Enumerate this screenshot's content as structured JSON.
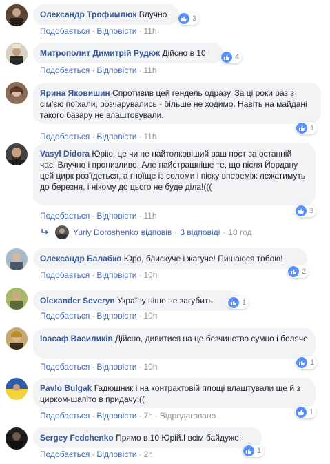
{
  "labels": {
    "like": "Подобається",
    "reply": "Відповісти",
    "edited": "Відредаговано",
    "separator": "·"
  },
  "comments": [
    {
      "author": "Олександр Трофимлюк",
      "text": "Влучно",
      "time": "11h",
      "reactions": "3",
      "avatar_color": "#4a3a2e"
    },
    {
      "author": "Митрополит Димитрій Рудюк",
      "text": "Дійсно в 10",
      "time": "11h",
      "reactions": "4",
      "avatar_color": "#6b5a3a"
    },
    {
      "author": "Ярина Яковишин",
      "text": "Спротивив цей гендель одразу. За ці роки раз з сім'єю поїхали, розчарувались - більше не ходимо. Навіть на майдані такого базару не влаштовували.",
      "time": "11h",
      "reactions": "1",
      "avatar_color": "#7a5a48"
    },
    {
      "author": "Vasyl Didora",
      "text": "Юрію, це чи не найтолковіший ваш пост за останній час! Влучно і пронизливо. Але найстрашніше те, що після Йордану цей цирк роз'їдеться, а гноїще із соломи і піску впереміж лежатимуть до березня, і нікому до цього не буде діла!(((",
      "time": "11h",
      "reactions": "3",
      "avatar_color": "#3b3b3b"
    },
    {
      "author": "Олександр Балабко",
      "text": "Юро, блискуче і жагуче! Пишаюся тобою!",
      "time": "10h",
      "reactions": "2",
      "avatar_color": "#8fa4b8"
    },
    {
      "author": "Olexander Severyn",
      "text": "Україну ніщо не загубить",
      "time": "10h",
      "reactions": "1",
      "avatar_color": "#9aa860"
    },
    {
      "author": "Іоасаф Василиків",
      "text": "Дійсно, дивитися на це безчинство сумно і боляче",
      "time": "10h",
      "reactions": "1",
      "avatar_color": "#a68450"
    },
    {
      "author": "Pavlo Bulgak",
      "text": "Гадюшник і на контрактовій площі влаштували ще й з цирком-шапіто в придачу:((",
      "time": "7h",
      "reactions": "1",
      "edited": true,
      "avatar_color": "#2f5aa8"
    },
    {
      "author": "Sergey Fedchenko",
      "text": "Прямо в 10 Юрій.І всім байдуже!",
      "time": "2h",
      "reactions": "1",
      "avatar_color": "#2a2a2a"
    }
  ],
  "replies_row": {
    "name": "Yuriy Doroshenko",
    "replied": "відповів",
    "count": "3 відповіді",
    "time": "10 год"
  },
  "colors": {
    "link": "#365899",
    "accent": "#4267b2",
    "bubble": "#f2f3f5",
    "like": "#5890ff"
  }
}
